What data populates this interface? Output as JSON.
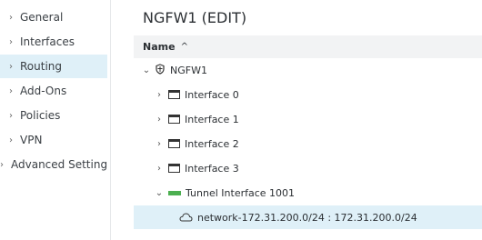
{
  "sidebar": {
    "items": [
      {
        "label": "General",
        "active": false
      },
      {
        "label": "Interfaces",
        "active": false
      },
      {
        "label": "Routing",
        "active": true
      },
      {
        "label": "Add-Ons",
        "active": false
      },
      {
        "label": "Policies",
        "active": false
      },
      {
        "label": "VPN",
        "active": false
      },
      {
        "label": "Advanced Setting",
        "active": false
      }
    ],
    "chevron": "›"
  },
  "main": {
    "title": "NGFW1 (EDIT)",
    "column": {
      "label": "Name",
      "sort_icon": "^"
    },
    "tree": {
      "root": {
        "label": "NGFW1",
        "expanded_icon": "⌄"
      },
      "interfaces": [
        {
          "label": "Interface 0"
        },
        {
          "label": "Interface 1"
        },
        {
          "label": "Interface 2"
        },
        {
          "label": "Interface 3"
        }
      ],
      "tunnel": {
        "label": "Tunnel Interface 1001"
      },
      "network": {
        "label": "network-172.31.200.0/24 : 172.31.200.0/24"
      },
      "collapsed_icon": "›",
      "expanded_icon": "⌄"
    }
  },
  "colors": {
    "selected": "#dff0f8",
    "header": "#f2f3f4",
    "tunnel": "#4caf50"
  }
}
